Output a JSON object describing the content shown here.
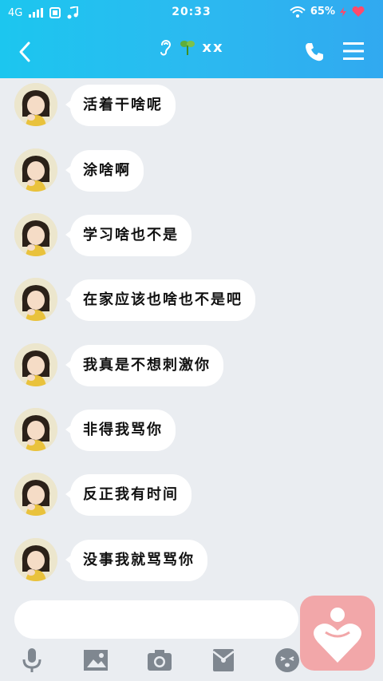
{
  "status_bar": {
    "network": "4G",
    "time": "20:33",
    "battery": "65%"
  },
  "header": {
    "title": "xx",
    "title_emoji_left": "ear-icon",
    "title_emoji_mid": "leaf-icon"
  },
  "messages": [
    {
      "text": "活着干啥呢"
    },
    {
      "text": "涂啥啊"
    },
    {
      "text": "学习啥也不是"
    },
    {
      "text": "在家应该也啥也不是吧"
    },
    {
      "text": "我真是不想刺激你"
    },
    {
      "text": "非得我骂你"
    },
    {
      "text": "反正我有时间"
    },
    {
      "text": "没事我就骂骂你"
    }
  ],
  "colors": {
    "header_start": "#1cc6ef",
    "header_end": "#31a9f0",
    "chat_bg": "#eaedf1",
    "float_button": "#f2a7a9"
  },
  "toolbar": {
    "icons": [
      "microphone-icon",
      "image-icon",
      "camera-icon",
      "red-packet-icon",
      "emoji-icon"
    ]
  }
}
